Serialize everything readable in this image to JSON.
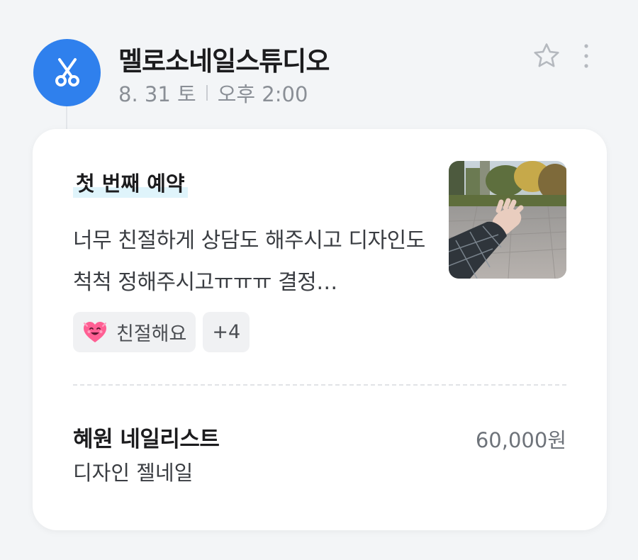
{
  "header": {
    "shop_name": "멜로소네일스튜디오",
    "date": "8. 31 토",
    "time": "오후 2:00",
    "avatar_icon": "scissors-icon",
    "favorite_icon": "star-icon",
    "more_icon": "more-vertical-icon"
  },
  "review": {
    "badge": "첫 번째 예약",
    "text": "너무 친절하게 상담도 해주시고 디자인도 척척 정해주시고ㅠㅠㅠ 결정…",
    "photo_alt": "hand-photo",
    "tags": [
      {
        "icon": "heart-emoji",
        "label": "친절해요"
      }
    ],
    "more_tags": "+4"
  },
  "booking": {
    "designer": "혜원 네일리스트",
    "service": "디자인 젤네일",
    "price": "60,000원"
  },
  "colors": {
    "accent": "#2f80ed",
    "background": "#f3f5f7",
    "badge_highlight": "#dff4fb"
  }
}
